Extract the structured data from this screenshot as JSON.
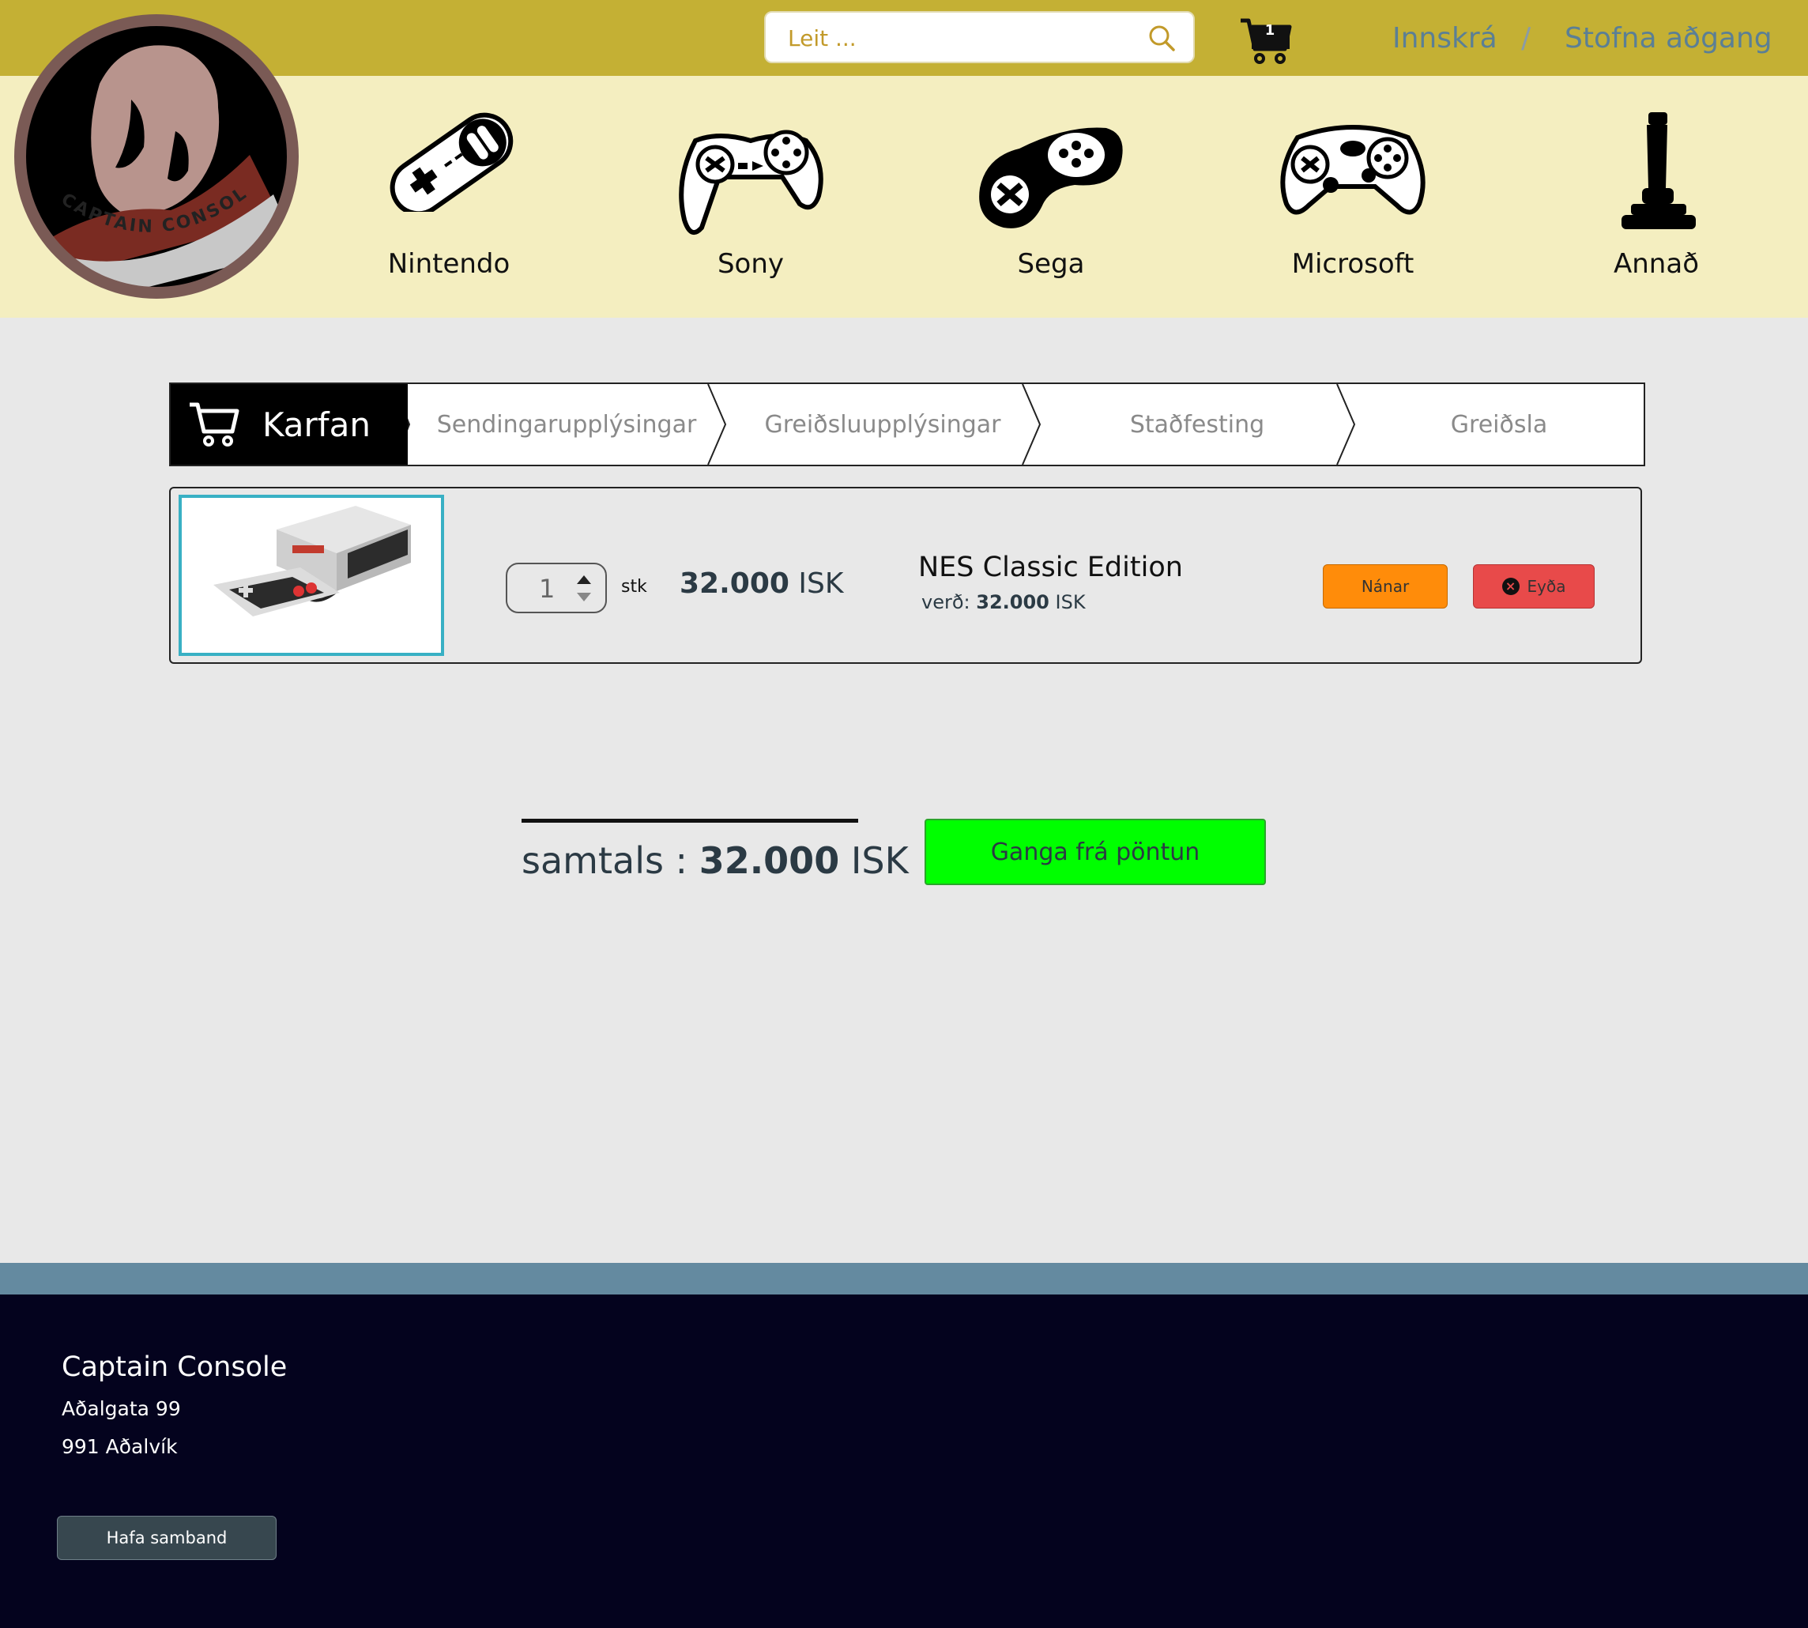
{
  "header": {
    "search_placeholder": "Leit ...",
    "cart_count": "1",
    "login": "Innskrá",
    "separator": "/",
    "signup": "Stofna aðgang"
  },
  "categories": [
    {
      "label": "Nintendo",
      "icon": "snes-controller-icon"
    },
    {
      "label": "Sony",
      "icon": "playstation-controller-icon"
    },
    {
      "label": "Sega",
      "icon": "sega-controller-icon"
    },
    {
      "label": "Microsoft",
      "icon": "xbox-controller-icon"
    },
    {
      "label": "Annað",
      "icon": "joystick-icon"
    }
  ],
  "logo": {
    "text": "CAPTAIN CONSOLE"
  },
  "steps": {
    "active": "Karfan",
    "items": [
      "Sendingarupplýsingar",
      "Greiðsluupplýsingar",
      "Staðfesting",
      "Greiðsla"
    ]
  },
  "cart": {
    "items": [
      {
        "name": "NES Classic Edition",
        "quantity": "1",
        "unit": "stk",
        "line_total_value": "32.000",
        "currency": "ISK",
        "price_label": "verð:",
        "price_value": "32.000",
        "more_label": "Nánar",
        "delete_label": "Eyða"
      }
    ],
    "total_label": "samtals :",
    "total_value": "32.000",
    "total_currency": "ISK",
    "checkout_label": "Ganga frá pöntun"
  },
  "footer": {
    "company": "Captain Console",
    "address1": "Aðalgata 99",
    "address2": "991 Aðalvík",
    "contact_label": "Hafa samband"
  },
  "colors": {
    "topbar": "#c4b034",
    "category_band": "#f4eec0",
    "link": "#5b7f95",
    "more_button": "#ff8c0a",
    "delete_button": "#e84a4a",
    "checkout_button": "#00ff00",
    "footer_stripe": "#648aa0",
    "footer": "#04031e"
  }
}
